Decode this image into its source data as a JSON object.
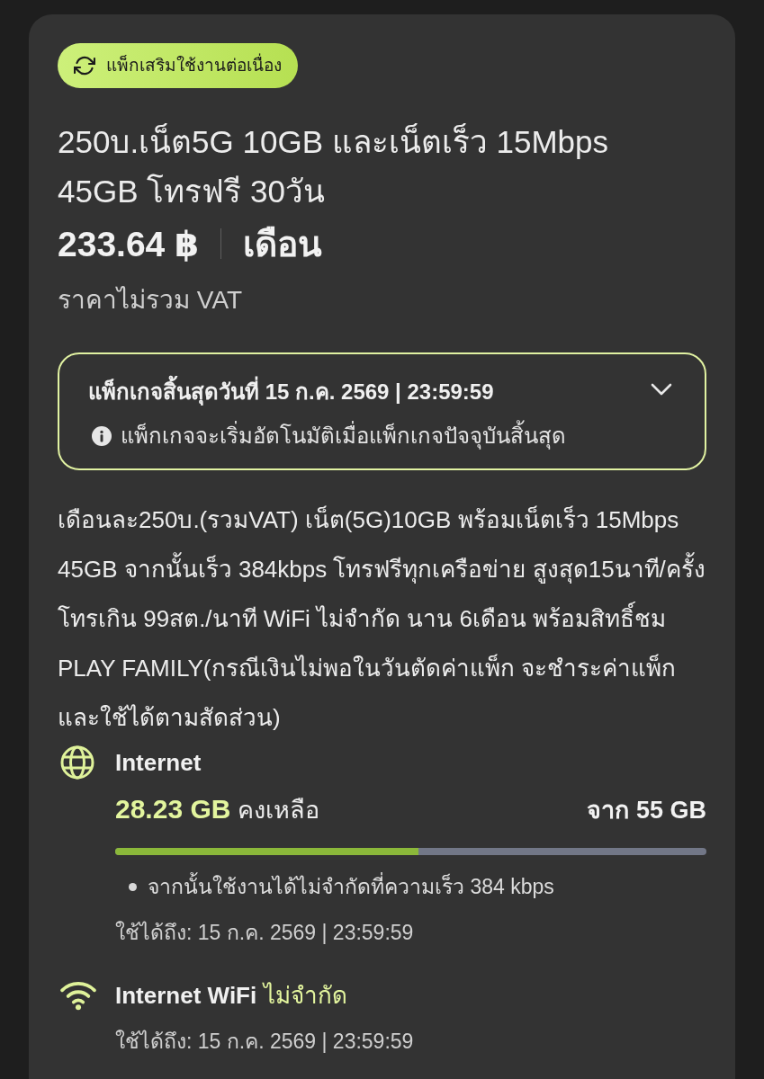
{
  "badge": {
    "label": "แพ็กเสริมใช้งานต่อเนื่อง"
  },
  "package": {
    "title": "250บ.เน็ต5G 10GB และเน็ตเร็ว 15Mbps 45GB โทรฟรี 30วัน",
    "price": "233.64 ฿",
    "period": "เดือน",
    "vat_note": "ราคาไม่รวม VAT"
  },
  "expiry": {
    "title": "แพ็กเกจสิ้นสุดวันที่ 15 ก.ค. 2569 | 23:59:59",
    "note": "แพ็กเกจจะเริ่มอัตโนมัติเมื่อแพ็กเกจปัจจุบันสิ้นสุด",
    "expanded": false
  },
  "description": "เดือนละ250บ.(รวมVAT) เน็ต(5G)10GB พร้อมเน็ตเร็ว 15Mbps 45GB จากนั้นเร็ว 384kbps โทรฟรีทุกเครือข่าย สูงสุด15นาที/ครั้ง โทรเกิน 99สต./นาที WiFi ไม่จำกัด นาน 6เดือน พร้อมสิทธิ์ชม PLAY FAMILY(กรณีเงินไม่พอในวันตัดค่าแพ็ก จะชำระค่าแพ็กและใช้ได้ตามสัดส่วน)",
  "quotas": [
    {
      "kind": "data",
      "name": "Internet",
      "remaining": "28.23 GB",
      "remaining_label": "คงเหลือ",
      "total": "จาก 55 GB",
      "level": 0.513,
      "notes": [
        "จากนั้นใช้งานได้ไม่จำกัดที่ความเร็ว 384 kbps"
      ],
      "valid_until": "ใช้ได้ถึง: 15 ก.ค. 2569 | 23:59:59"
    },
    {
      "kind": "wifi",
      "name": "Internet WiFi",
      "allowance": "ไม่จำกัด",
      "valid_until": "ใช้ได้ถึง: 15 ก.ค. 2569 | 23:59:59"
    }
  ]
}
